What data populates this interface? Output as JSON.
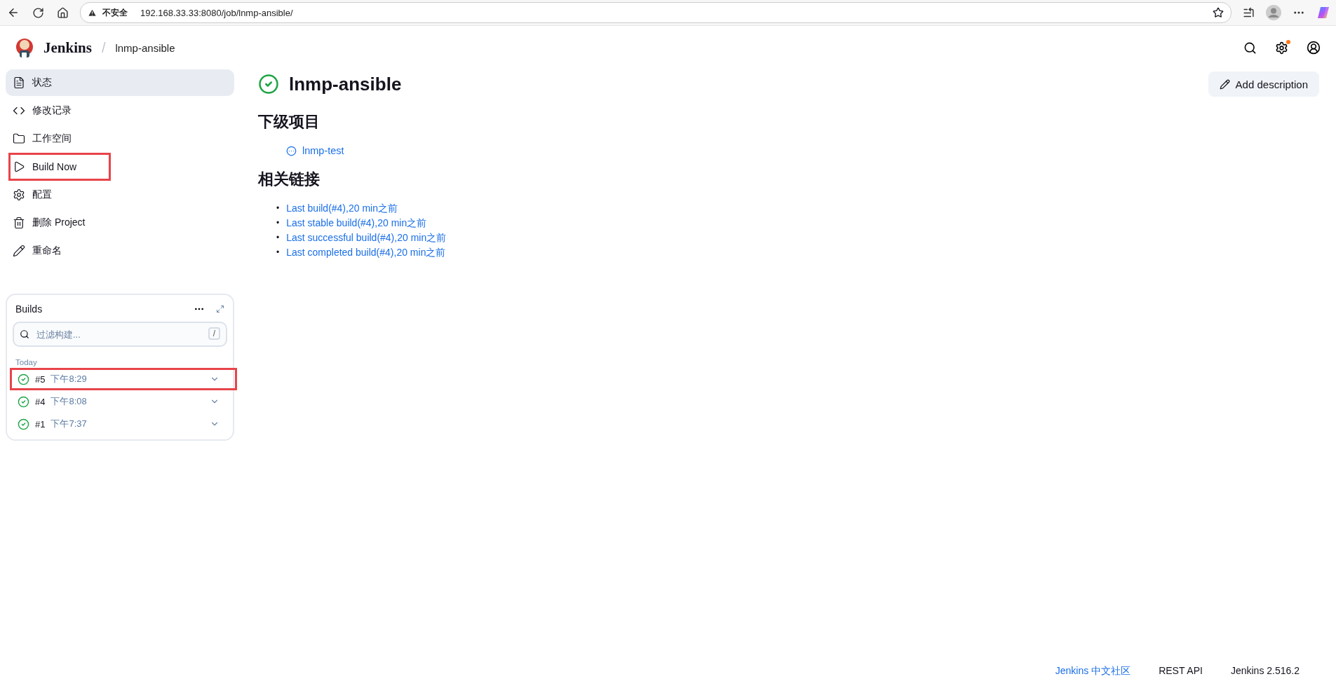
{
  "browser": {
    "security_label": "不安全",
    "url": "192.168.33.33:8080/job/lnmp-ansible/"
  },
  "header": {
    "brand": "Jenkins",
    "separator": "/",
    "breadcrumb": "lnmp-ansible",
    "settings_notification": true
  },
  "sidebar": {
    "items": [
      {
        "kind": "status",
        "label": "状态",
        "selected": true,
        "highlighted": false
      },
      {
        "kind": "changes",
        "label": "修改记录",
        "selected": false,
        "highlighted": false
      },
      {
        "kind": "workspace",
        "label": "工作空间",
        "selected": false,
        "highlighted": false
      },
      {
        "kind": "build",
        "label": "Build Now",
        "selected": false,
        "highlighted": true
      },
      {
        "kind": "configure",
        "label": "配置",
        "selected": false,
        "highlighted": false
      },
      {
        "kind": "delete",
        "label": "删除 Project",
        "selected": false,
        "highlighted": false
      },
      {
        "kind": "rename",
        "label": "重命名",
        "selected": false,
        "highlighted": false
      }
    ]
  },
  "builds": {
    "title": "Builds",
    "filter_placeholder": "过滤构建...",
    "shortcut_key": "/",
    "group_label": "Today",
    "rows": [
      {
        "number": "#5",
        "time": "下午8:29",
        "kind": "success",
        "highlighted": true
      },
      {
        "number": "#4",
        "time": "下午8:08",
        "kind": "success",
        "highlighted": false
      },
      {
        "number": "#1",
        "time": "下午7:37",
        "kind": "success",
        "highlighted": false
      }
    ]
  },
  "job": {
    "title": "lnmp-ansible",
    "kind": "success",
    "add_description": "Add description"
  },
  "subprojects": {
    "heading": "下级项目",
    "items": [
      {
        "name": "lnmp-test",
        "kind": "notbuilt"
      }
    ]
  },
  "related_links": {
    "heading": "相关链接",
    "links": [
      {
        "marker": "•",
        "label": "Last build(#4),20 min之前"
      },
      {
        "marker": "•",
        "label": "Last stable build(#4),20 min之前"
      },
      {
        "marker": "•",
        "label": "Last successful build(#4),20 min之前"
      },
      {
        "marker": "•",
        "label": "Last completed build(#4),20 min之前"
      }
    ]
  },
  "footer": {
    "links": [
      {
        "label": "Jenkins 中文社区",
        "kind": "link"
      },
      {
        "label": "REST API",
        "kind": "button"
      },
      {
        "label": "Jenkins 2.516.2",
        "kind": "button"
      }
    ]
  }
}
